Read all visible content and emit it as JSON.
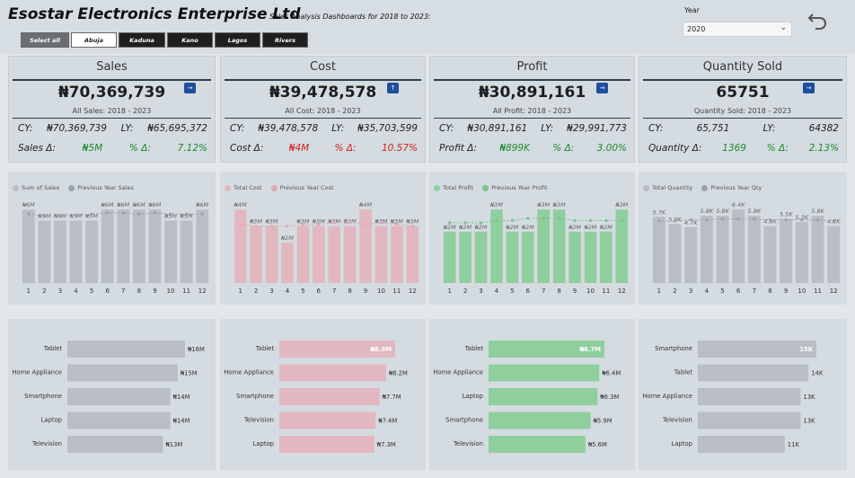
{
  "header": {
    "title": "Esostar Electronics Enterprise Ltd",
    "subtitle": "Sales Analysis Dashboards for 2018 to 2023:"
  },
  "slicer": {
    "items": [
      "Select all",
      "Abuja",
      "Kaduna",
      "Kano",
      "Lagos",
      "Rivers"
    ]
  },
  "year_filter": {
    "label": "Year",
    "value": "2020"
  },
  "kpis": [
    {
      "title": "Sales",
      "value": "₦70,369,739",
      "sub": "All Sales: 2018 - 2023",
      "icon": "arrow-right-icon",
      "cy_label": "CY:",
      "cy": "₦70,369,739",
      "ly_label": "LY:",
      "ly": "₦65,695,372",
      "delta_label": "Sales Δ:",
      "delta": "₦5M",
      "pct_label": "% Δ:",
      "pct": "7.12%",
      "delta_positive": true
    },
    {
      "title": "Cost",
      "value": "₦39,478,578",
      "sub": "All Cost: 2018 - 2023",
      "icon": "arrow-up-icon",
      "cy_label": "CY:",
      "cy": "₦39,478,578",
      "ly_label": "LY:",
      "ly": "₦35,703,599",
      "delta_label": "Cost Δ:",
      "delta": "₦4M",
      "pct_label": "% Δ:",
      "pct": "10.57%",
      "delta_positive": false
    },
    {
      "title": "Profit",
      "value": "₦30,891,161",
      "sub": "All Profit: 2018 - 2023",
      "icon": "arrow-right-icon",
      "cy_label": "CY:",
      "cy": "₦30,891,161",
      "ly_label": "LY:",
      "ly": "₦29,991,773",
      "delta_label": "Profit Δ:",
      "delta": "₦899K",
      "pct_label": "% Δ:",
      "pct": "3.00%",
      "delta_positive": true
    },
    {
      "title": "Quantity Sold",
      "value": "65751",
      "sub": "Quantity Sold: 2018 - 2023",
      "icon": "arrow-right-icon",
      "cy_label": "CY:",
      "cy": "65,751",
      "ly_label": "LY:",
      "ly": "64382",
      "delta_label": "Quantity Δ:",
      "delta": "1369",
      "pct_label": "% Δ:",
      "pct": "2.13%",
      "delta_positive": true
    }
  ],
  "chart_data": [
    {
      "type": "bar",
      "legend": [
        "Sum of Sales",
        "Previous Year Sales"
      ],
      "categories": [
        "1",
        "2",
        "3",
        "4",
        "5",
        "6",
        "7",
        "8",
        "9",
        "10",
        "11",
        "12"
      ],
      "series": [
        {
          "name": "Sum of Sales",
          "values": [
            6,
            5,
            5,
            5,
            5,
            6,
            6,
            6,
            6,
            5,
            5,
            6
          ]
        },
        {
          "name": "Previous Year Sales",
          "values": [
            5.6,
            5.4,
            5.4,
            5.5,
            5.6,
            5.7,
            5.7,
            5.6,
            5.7,
            5.6,
            5.6,
            5.6
          ]
        }
      ],
      "labels": [
        "₦6M",
        "₦5M",
        "₦5M",
        "₦5M",
        "₦5M",
        "₦6M",
        "₦6M",
        "₦6M",
        "₦6M",
        "₦5M",
        "₦5M",
        "₦6M"
      ],
      "color": "#b8bec4",
      "line_color": "#9aa1a7"
    },
    {
      "type": "bar",
      "legend": [
        "Total Cost",
        "Previous Year Cost"
      ],
      "categories": [
        "1",
        "2",
        "3",
        "4",
        "5",
        "6",
        "7",
        "8",
        "9",
        "10",
        "11",
        "12"
      ],
      "series": [
        {
          "name": "Total Cost",
          "values": [
            4,
            3,
            3,
            2,
            3,
            3,
            3,
            3,
            4,
            3,
            3,
            3
          ]
        },
        {
          "name": "Previous Year Cost",
          "values": [
            3.1,
            3.0,
            3.0,
            3.0,
            3.1,
            3.1,
            3.2,
            3.3,
            3.1,
            3.2,
            3.1,
            3.0
          ]
        }
      ],
      "labels": [
        "₦4M",
        "₦3M",
        "₦3M",
        "₦2M",
        "₦3M",
        "₦3M",
        "₦3M",
        "₦3M",
        "₦4M",
        "₦3M",
        "₦3M",
        "₦3M"
      ],
      "color": "#e3b7bf",
      "line_color": "#e3a8b2"
    },
    {
      "type": "bar",
      "legend": [
        "Total Profit",
        "Previous Year Profit"
      ],
      "categories": [
        "1",
        "2",
        "3",
        "4",
        "5",
        "6",
        "7",
        "8",
        "9",
        "10",
        "11",
        "12"
      ],
      "series": [
        {
          "name": "Total Profit",
          "values": [
            2,
            2,
            2,
            3,
            2,
            2,
            3,
            3,
            2,
            2,
            2,
            3
          ]
        },
        {
          "name": "Previous Year Profit",
          "values": [
            2.4,
            2.4,
            2.4,
            2.5,
            2.5,
            2.6,
            2.6,
            2.6,
            2.5,
            2.5,
            2.5,
            2.5
          ]
        }
      ],
      "labels": [
        "₦2M",
        "₦2M",
        "₦2M",
        "₦3M",
        "₦2M",
        "₦2M",
        "₦3M",
        "₦3M",
        "₦2M",
        "₦2M",
        "₦2M",
        "₦3M"
      ],
      "color": "#8fcf9e",
      "line_color": "#7fc08f"
    },
    {
      "type": "bar",
      "legend": [
        "Total Quantity",
        "Previous Year Qty"
      ],
      "categories": [
        "1",
        "2",
        "3",
        "4",
        "5",
        "6",
        "7",
        "8",
        "9",
        "10",
        "11",
        "12"
      ],
      "series": [
        {
          "name": "Total Quantity",
          "values": [
            5.7,
            5.0,
            4.7,
            5.8,
            5.8,
            6.4,
            5.8,
            4.8,
            5.5,
            5.2,
            5.8,
            4.8
          ]
        },
        {
          "name": "Previous Year Qty",
          "values": [
            5.3,
            5.3,
            5.4,
            5.4,
            5.5,
            5.5,
            5.5,
            5.4,
            5.4,
            5.4,
            5.4,
            5.3
          ]
        }
      ],
      "labels": [
        "5.7K",
        "5.0K",
        "4.7K",
        "5.8K",
        "5.8K",
        "6.4K",
        "5.8K",
        "4.8K",
        "5.5K",
        "5.2K",
        "5.8K",
        "4.8K"
      ],
      "color": "#b8bec4",
      "line_color": "#9aa1a7"
    },
    {
      "type": "bar",
      "orientation": "horizontal",
      "categories": [
        "Tablet",
        "Home Appliance",
        "Smartphone",
        "Laptop",
        "Television"
      ],
      "values": [
        16,
        15,
        14,
        14,
        13
      ],
      "labels": [
        "₦16M",
        "₦15M",
        "₦14M",
        "₦14M",
        "₦13M"
      ],
      "color": "#b8bec4"
    },
    {
      "type": "bar",
      "orientation": "horizontal",
      "categories": [
        "Tablet",
        "Home Appliance",
        "Smartphone",
        "Television",
        "Laptop"
      ],
      "values": [
        8.9,
        8.2,
        7.7,
        7.4,
        7.3
      ],
      "labels": [
        "₦8.9M",
        "₦8.2M",
        "₦7.7M",
        "₦7.4M",
        "₦7.3M"
      ],
      "color": "#e3b7bf"
    },
    {
      "type": "bar",
      "orientation": "horizontal",
      "categories": [
        "Tablet",
        "Home Appliance",
        "Laptop",
        "Smartphone",
        "Television"
      ],
      "values": [
        6.7,
        6.4,
        6.3,
        5.9,
        5.6
      ],
      "labels": [
        "₦6.7M",
        "₦6.4M",
        "₦6.3M",
        "₦5.9M",
        "₦5.6M"
      ],
      "color": "#8fcf9e"
    },
    {
      "type": "bar",
      "orientation": "horizontal",
      "categories": [
        "Smartphone",
        "Tablet",
        "Home Appliance",
        "Television",
        "Laptop"
      ],
      "values": [
        15,
        14,
        13,
        13,
        11
      ],
      "labels": [
        "15K",
        "14K",
        "13K",
        "13K",
        "11K"
      ],
      "color": "#b8bec4"
    }
  ]
}
